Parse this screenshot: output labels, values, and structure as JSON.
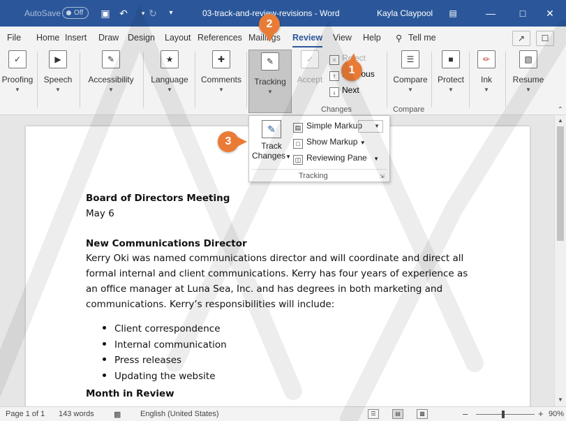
{
  "titlebar": {
    "autosave": "AutoSave",
    "toggle": "Off",
    "doc_title": "03-track-and-review-revisions - Word",
    "user": "Kayla Claypool"
  },
  "tabs": [
    "File",
    "Home",
    "Insert",
    "Draw",
    "Design",
    "Layout",
    "References",
    "Mailings",
    "Review",
    "View",
    "Help"
  ],
  "active_tab": "Review",
  "tell_me": "Tell me",
  "ribbon": {
    "proofing": "Proofing",
    "speech": "Speech",
    "accessibility": "Accessibility",
    "language": "Language",
    "comments": "Comments",
    "tracking": "Tracking",
    "accept": "Accept",
    "reject": "Reject",
    "previous": "Previous",
    "next": "Next",
    "changes_group": "Changes",
    "compare": "Compare",
    "compare_group": "Compare",
    "protect": "Protect",
    "ink": "Ink",
    "resume": "Resume"
  },
  "popup": {
    "track_changes_1": "Track",
    "track_changes_2": "Changes",
    "simple_markup": "Simple Markup",
    "show_markup": "Show Markup",
    "reviewing_pane": "Reviewing Pane",
    "group": "Tracking"
  },
  "document": {
    "heading1": "Board of Directors Meeting",
    "date": "May 6",
    "heading2": "New Communications Director",
    "para": [
      "Kerry Oki was named communications director and will coordinate and direct all",
      "formal internal and client communications. Kerry has four years of experience as",
      "an office manager at Luna Sea, Inc. and has degrees in both marketing and",
      "communications. Kerry’s responsibilities will include:"
    ],
    "bullets": [
      "Client correspondence",
      "Internal communication",
      "Press releases",
      "Updating the website"
    ],
    "heading3": "Month in Review"
  },
  "status": {
    "page": "Page 1 of 1",
    "words": "143 words",
    "language": "English (United States)",
    "zoom": "90%"
  },
  "callouts": [
    "1",
    "2",
    "3"
  ],
  "colors": {
    "titlebar": "#2b579a",
    "callout": "#e97b37",
    "ribbon": "#f3f3f3"
  }
}
